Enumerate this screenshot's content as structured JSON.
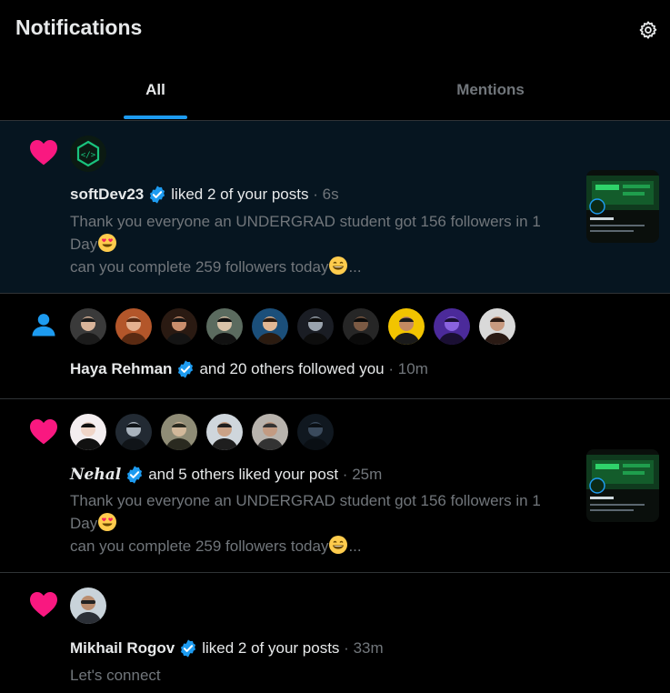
{
  "header": {
    "title": "Notifications",
    "settings_icon": "gear-icon"
  },
  "tabs": [
    {
      "label": "All",
      "active": true
    },
    {
      "label": "Mentions",
      "active": false
    }
  ],
  "colors": {
    "accent": "#1d9bf0",
    "like": "#f91880",
    "follow": "#1d9bf0",
    "muted": "#71767b",
    "unread_bg": "#061520"
  },
  "notifications": [
    {
      "type_icon": "heart-icon",
      "actor": "softDev23",
      "action": "liked 2 of your posts",
      "separator": "·",
      "time": "6s",
      "text_line1": "Thank you everyone an UNDERGRAD student got 156 followers in 1 Day",
      "text_line2": " can you complete 259 followers today",
      "ellipsis": "...",
      "has_thumbnail": true
    },
    {
      "type_icon": "person-icon",
      "actor": "Haya Rehman",
      "action": "and 20 others followed you",
      "separator": "·",
      "time": "10m",
      "avatar_count": 10
    },
    {
      "type_icon": "heart-icon",
      "actor": "Nehal",
      "action": "and 5 others liked your post",
      "separator": "·",
      "time": "25m",
      "text_line1": "Thank you everyone an UNDERGRAD student got 156 followers in 1 Day",
      "text_line2": " can you complete 259 followers today",
      "ellipsis": "...",
      "has_thumbnail": true,
      "avatar_count": 6
    },
    {
      "type_icon": "heart-icon",
      "actor": "Mikhail Rogov",
      "action": "liked 2 of your posts",
      "separator": "·",
      "time": "33m",
      "text_line1": "Let's connect"
    }
  ]
}
